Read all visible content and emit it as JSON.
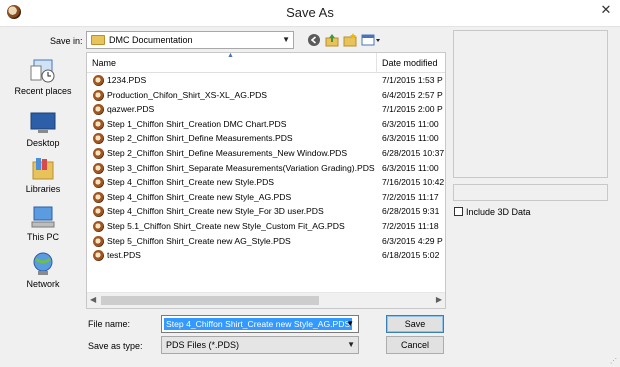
{
  "window": {
    "title": "Save As",
    "close_glyph": "✕"
  },
  "savein": {
    "label": "Save in:",
    "value": "DMC Documentation"
  },
  "toolbar": {
    "icons": [
      "back-icon",
      "up-folder-icon",
      "new-folder-icon",
      "view-menu-icon"
    ]
  },
  "places": [
    {
      "label": "Recent places",
      "icon": "recent-places-icon"
    },
    {
      "label": "Desktop",
      "icon": "desktop-icon"
    },
    {
      "label": "Libraries",
      "icon": "libraries-icon"
    },
    {
      "label": "This PC",
      "icon": "this-pc-icon"
    },
    {
      "label": "Network",
      "icon": "network-icon"
    }
  ],
  "filelist": {
    "columns": {
      "name": "Name",
      "date": "Date modified"
    },
    "rows": [
      {
        "name": "1234.PDS",
        "date": "7/1/2015 1:53 P"
      },
      {
        "name": "Production_Chifon_Shirt_XS-XL_AG.PDS",
        "date": "6/4/2015 2:57 P"
      },
      {
        "name": "qazwer.PDS",
        "date": "7/1/2015 2:00 P"
      },
      {
        "name": "Step 1_Chiffon Shirt_Creation DMC Chart.PDS",
        "date": "6/3/2015 11:00"
      },
      {
        "name": "Step 2_Chiffon Shirt_Define Measurements.PDS",
        "date": "6/3/2015 11:00"
      },
      {
        "name": "Step 2_Chiffon Shirt_Define Measurements_New Window.PDS",
        "date": "6/28/2015 10:37"
      },
      {
        "name": "Step 3_Chiffon Shirt_Separate Measurements(Variation Grading).PDS",
        "date": "6/3/2015 11:00"
      },
      {
        "name": "Step 4_Chiffon Shirt_Create new Style.PDS",
        "date": "7/16/2015 10:42"
      },
      {
        "name": "Step 4_Chiffon Shirt_Create new Style_AG.PDS",
        "date": "7/2/2015 11:17"
      },
      {
        "name": "Step 4_Chiffon Shirt_Create new Style_For 3D user.PDS",
        "date": "6/28/2015 9:31"
      },
      {
        "name": "Step 5.1_Chiffon Shirt_Create new Style_Custom Fit_AG.PDS",
        "date": "7/2/2015 11:18"
      },
      {
        "name": "Step 5_Chiffon Shirt_Create new AG_Style.PDS",
        "date": "6/3/2015 4:29 P"
      },
      {
        "name": "test.PDS",
        "date": "6/18/2015 5:02"
      }
    ]
  },
  "include3d": {
    "label": "Include 3D Data",
    "checked": false
  },
  "filename": {
    "label": "File name:",
    "value": "Step 4_Chiffon Shirt_Create new Style_AG.PDS"
  },
  "savetype": {
    "label": "Save as type:",
    "value": "PDS Files (*.PDS)"
  },
  "buttons": {
    "save": "Save",
    "cancel": "Cancel"
  },
  "colors": {
    "selection": "#3399ff",
    "folder": "#e8c25a",
    "accent": "#3c7fb1"
  }
}
